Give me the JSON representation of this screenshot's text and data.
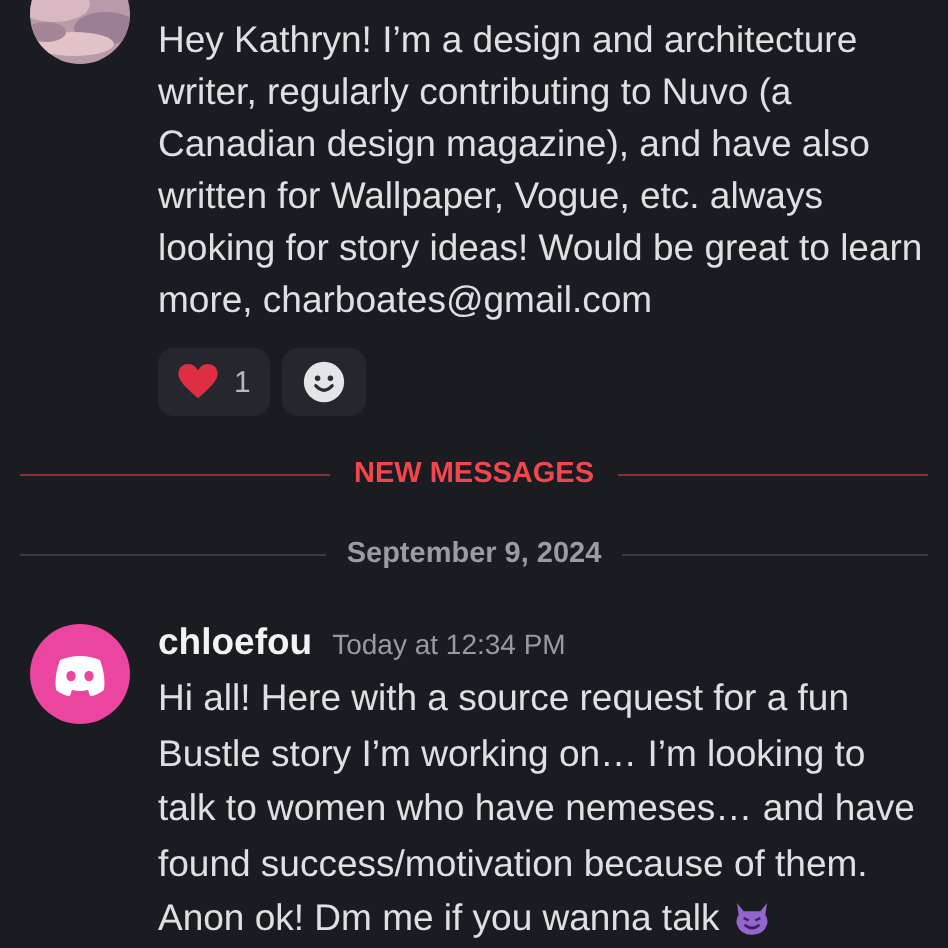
{
  "messages": [
    {
      "text": "Hey Kathryn! I’m a design and architecture writer, regularly contributing to Nuvo (a Canadian design magazine), and have also written for Wallpaper, Vogue, etc. always looking for story ideas! Would be great to learn more, charboates@gmail.com",
      "reactions": [
        {
          "kind": "heart",
          "count": "1"
        },
        {
          "kind": "add"
        }
      ]
    }
  ],
  "new_messages_divider": "NEW MESSAGES",
  "date_divider": "September 9, 2024",
  "latest": {
    "avatar": {
      "kind": "discord",
      "color": "#eb459f"
    },
    "author": "chloefou",
    "time": "Today at 12:34 PM",
    "text": "Hi all! Here with a source request for a fun Bustle story I’m working on… I’m looking to talk to women who have nemeses… and have found success/motivation because of them.",
    "closing_text": "Anon ok! Dm me if you wanna talk",
    "trailing_emoji": {
      "kind": "devil"
    }
  }
}
